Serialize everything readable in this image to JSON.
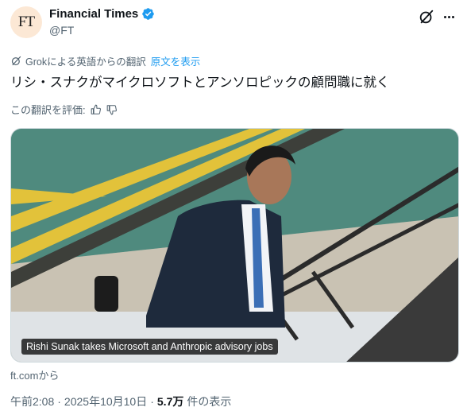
{
  "account": {
    "name": "Financial Times",
    "handle": "@FT",
    "avatar_text": "FT",
    "verified_color": "#1d9bf0"
  },
  "translation": {
    "label": "Grokによる英語からの翻訳",
    "show_original": "原文を表示"
  },
  "tweet": {
    "text": "リシ・スナクがマイクロソフトとアンソロピックの顧問職に就く"
  },
  "rating": {
    "label": "この翻訳を評価:"
  },
  "media": {
    "caption": "Rishi Sunak takes Microsoft and Anthropic advisory jobs"
  },
  "link": {
    "source": "ft.comから"
  },
  "meta": {
    "time": "午前2:08",
    "date": "2025年10月10日",
    "views_count": "5.7万",
    "views_label": "件の表示",
    "separator": "·"
  },
  "icons": {
    "grok": "grok-icon",
    "more": "more-icon",
    "thumbs_up": "thumbs-up-icon",
    "thumbs_down": "thumbs-down-icon",
    "verified": "verified-badge-icon"
  }
}
